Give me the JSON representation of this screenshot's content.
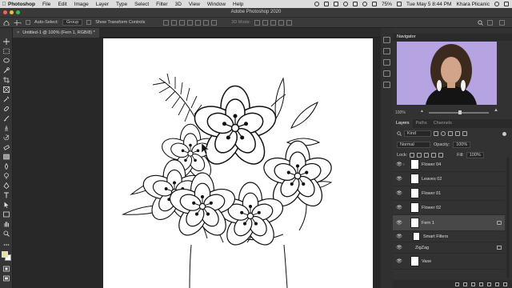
{
  "menubar": {
    "apple": "",
    "items": [
      "Photoshop",
      "File",
      "Edit",
      "Image",
      "Layer",
      "Type",
      "Select",
      "Filter",
      "3D",
      "View",
      "Window",
      "Help"
    ],
    "battery": "75%",
    "datetime": "Tue May 5  8:44 PM",
    "user": "Khara Plicanic"
  },
  "app": {
    "title": "Adobe Photoshop 2020"
  },
  "options": {
    "auto_select_label": "Auto-Select:",
    "auto_select_value": "Group",
    "transform_label": "Show Transform Controls",
    "mode_label": "3D Mode:"
  },
  "document": {
    "tab_title": "Untitled-1 @ 100% (Fern 1, RGB/8) *"
  },
  "navigator": {
    "title": "Navigator",
    "zoom": "100%"
  },
  "layers_panel": {
    "tabs": [
      "Layers",
      "Paths",
      "Channels"
    ],
    "filter_kind": "Kind",
    "blend_mode": "Normal",
    "opacity_label": "Opacity:",
    "opacity_value": "100%",
    "lock_label": "Lock:",
    "fill_label": "Fill:",
    "fill_value": "100%",
    "layers": [
      {
        "name": "Flower 04"
      },
      {
        "name": "Leaves 02"
      },
      {
        "name": "Flower 01"
      },
      {
        "name": "Flower 02"
      },
      {
        "name": "Fern 1",
        "selected": true
      },
      {
        "name": "Smart Filters",
        "sub": true
      },
      {
        "name": "ZigZag",
        "sub": true
      },
      {
        "name": "Vase"
      }
    ]
  }
}
